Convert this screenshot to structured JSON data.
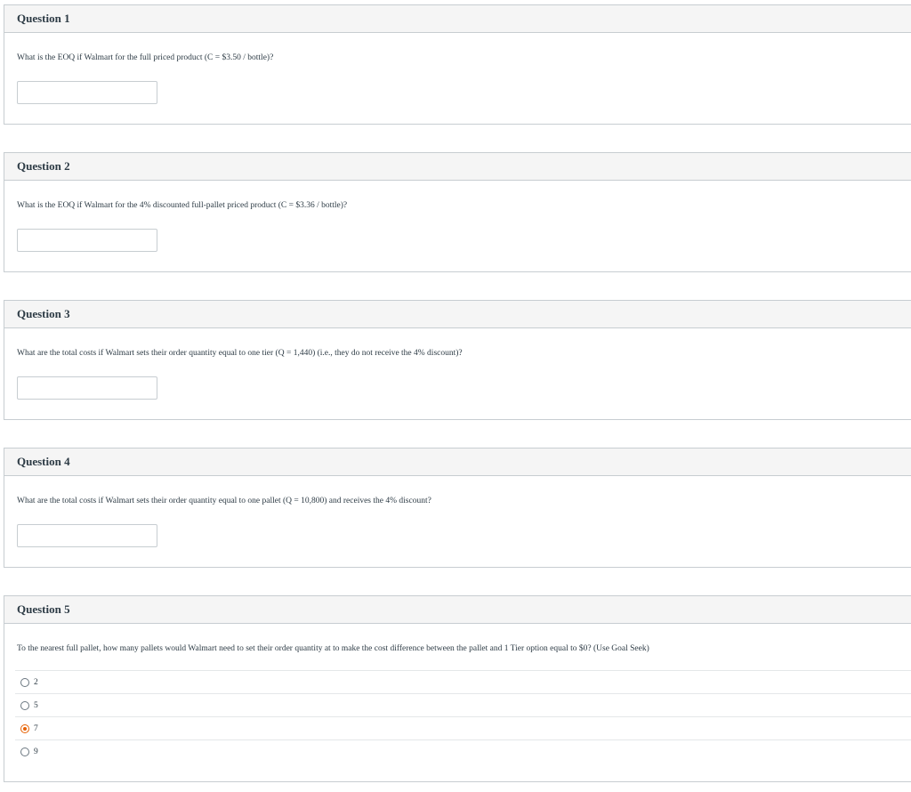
{
  "questions": [
    {
      "title": "Question 1",
      "text": "What is the EOQ if Walmart for the full priced product (C = $3.50 / bottle)?",
      "answer": ""
    },
    {
      "title": "Question 2",
      "text": "What is the EOQ if Walmart for the 4% discounted full-pallet priced product (C = $3.36 / bottle)?",
      "answer": ""
    },
    {
      "title": "Question 3",
      "text": "What are the total costs if Walmart sets their order quantity equal to one tier (Q = 1,440) (i.e., they do not receive the 4% discount)?",
      "answer": ""
    },
    {
      "title": "Question 4",
      "text": "What are the total costs if Walmart sets their order quantity equal to one pallet (Q = 10,800) and receives the 4% discount?",
      "answer": ""
    },
    {
      "title": "Question 5",
      "text": "To the nearest full pallet, how many pallets would Walmart need to set their order quantity at to make the cost difference between the pallet and 1 Tier option equal to $0? (Use Goal Seek)",
      "options": [
        "2",
        "5",
        "7",
        "9"
      ],
      "selected": "7"
    }
  ],
  "colors": {
    "header_bg": "#f5f5f5",
    "border": "#c7cdd1",
    "selected_radio": "#e66000",
    "text": "#2d3b45"
  }
}
